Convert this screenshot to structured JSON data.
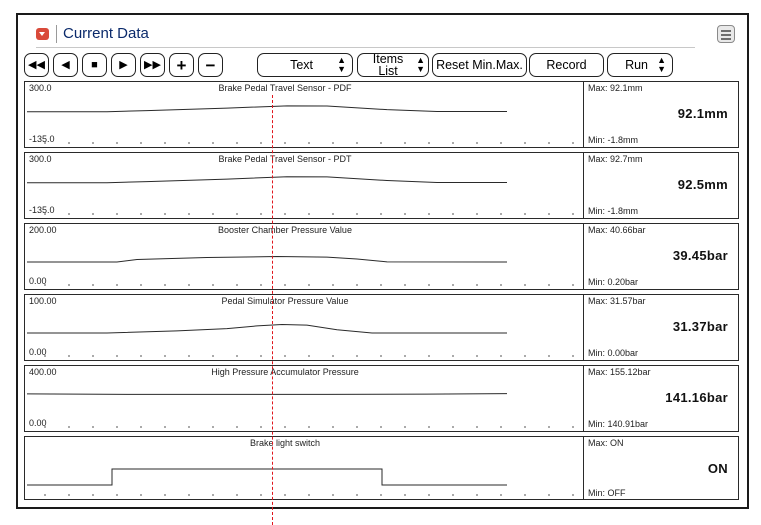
{
  "window": {
    "title": "Current Data",
    "icons": {
      "collapse": "chevron-down-icon",
      "settings": "list-menu-icon"
    },
    "colors": {
      "title": "#0b2a6b",
      "collapse_icon": "#d94a3a",
      "cursor": "#e0161d"
    }
  },
  "toolbar": {
    "rewind": "◀◀",
    "step_back": "◀",
    "stop": "■",
    "play": "▶",
    "fast_forward": "▶▶",
    "zoom_in": "+",
    "zoom_out": "−",
    "view_mode": "Text",
    "items_list": "Items List",
    "reset_min_max": "Reset Min.Max.",
    "record": "Record",
    "run": "Run"
  },
  "panels": [
    {
      "title": "Brake Pedal Travel Sensor - PDF",
      "y_max": "300.0",
      "y_min": "-135.0",
      "max_label": "Max:  92.1mm",
      "min_label": "Min:  -1.8mm",
      "current": "92.1mm",
      "chart_data": {
        "type": "line",
        "ylim": [
          -135,
          300
        ],
        "x": [
          0,
          80,
          120,
          200,
          260,
          300,
          360,
          410,
          480
        ],
        "y": [
          -3,
          -3,
          15,
          55,
          90,
          88,
          30,
          0,
          0
        ]
      }
    },
    {
      "title": "Brake Pedal Travel Sensor - PDT",
      "y_max": "300.0",
      "y_min": "-135.0",
      "max_label": "Max:  92.7mm",
      "min_label": "Min:  -1.8mm",
      "current": "92.5mm",
      "chart_data": {
        "type": "line",
        "ylim": [
          -135,
          300
        ],
        "x": [
          0,
          80,
          120,
          200,
          260,
          300,
          360,
          410,
          480
        ],
        "y": [
          -3,
          -3,
          15,
          55,
          92,
          90,
          32,
          0,
          0
        ]
      }
    },
    {
      "title": "Booster Chamber Pressure Value",
      "y_max": "200.00",
      "y_min": "0.00",
      "max_label": "Max: 40.66bar",
      "min_label": "Min:  0.20bar",
      "current": "39.45bar",
      "chart_data": {
        "type": "line",
        "ylim": [
          0,
          200
        ],
        "x": [
          0,
          90,
          110,
          180,
          250,
          300,
          330,
          360,
          480
        ],
        "y": [
          0.3,
          0.3,
          18,
          33,
          40,
          36,
          22,
          1,
          0.3
        ]
      }
    },
    {
      "title": "Pedal Simulator Pressure Value",
      "y_max": "100.00",
      "y_min": "0.00",
      "max_label": "Max: 31.57bar",
      "min_label": "Min:  0.00bar",
      "current": "31.37bar",
      "chart_data": {
        "type": "line",
        "ylim": [
          0,
          100
        ],
        "x": [
          0,
          80,
          150,
          200,
          230,
          255,
          280,
          310,
          345,
          480
        ],
        "y": [
          0,
          0,
          8,
          16,
          26,
          31,
          29,
          12,
          0,
          0
        ]
      }
    },
    {
      "title": "High Pressure Accumulator Pressure",
      "y_max": "400.00",
      "y_min": "0.00",
      "max_label": "Max: 155.12bar",
      "min_label": "Min: 140.91bar",
      "current": "141.16bar",
      "chart_data": {
        "type": "line",
        "ylim": [
          0,
          400
        ],
        "x": [
          0,
          100,
          200,
          300,
          400,
          480
        ],
        "y": [
          148,
          142,
          141,
          141,
          144,
          153
        ]
      }
    },
    {
      "title": "Brake light switch",
      "y_max": "",
      "y_min": "",
      "max_label": "Max:  ON",
      "min_label": "Min:  OFF",
      "current": "ON",
      "chart_data": {
        "type": "line",
        "ylim": [
          0,
          1
        ],
        "step": true,
        "x": [
          0,
          85,
          85,
          355,
          355,
          480
        ],
        "y": [
          0,
          0,
          1,
          1,
          0,
          0
        ]
      }
    }
  ]
}
